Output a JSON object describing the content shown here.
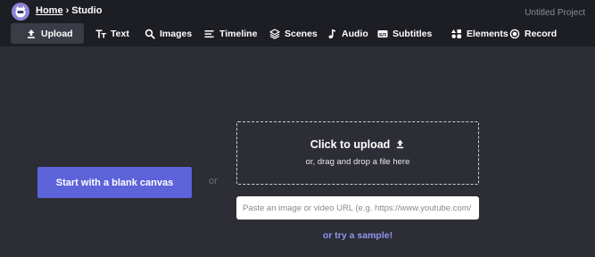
{
  "header": {
    "breadcrumb": {
      "home": "Home",
      "separator": "›",
      "current": "Studio"
    },
    "project_title": "Untitled Project"
  },
  "tabs": [
    {
      "label": "Upload",
      "icon": "upload-icon",
      "active": true
    },
    {
      "label": "Text",
      "icon": "text-icon"
    },
    {
      "label": "Images",
      "icon": "search-icon"
    },
    {
      "label": "Timeline",
      "icon": "timeline-icon"
    },
    {
      "label": "Scenes",
      "icon": "layers-icon"
    },
    {
      "label": "Audio",
      "icon": "music-note-icon"
    },
    {
      "label": "Subtitles",
      "icon": "subtitles-icon"
    },
    {
      "label": "Elements",
      "icon": "elements-icon"
    },
    {
      "label": "Record",
      "icon": "record-icon"
    }
  ],
  "main": {
    "blank_canvas_label": "Start with a blank canvas",
    "or_label": "or",
    "dropzone": {
      "title": "Click to upload",
      "subtitle": "or, drag and drop a file here"
    },
    "url_input": {
      "placeholder": "Paste an image or video URL (e.g. https://www.youtube.com/",
      "value": ""
    },
    "sample_link": "or try a sample!"
  },
  "colors": {
    "background": "#2c2d35",
    "topbar": "#1d1e24",
    "accent": "#5d63d9",
    "link": "#8f96ee"
  }
}
